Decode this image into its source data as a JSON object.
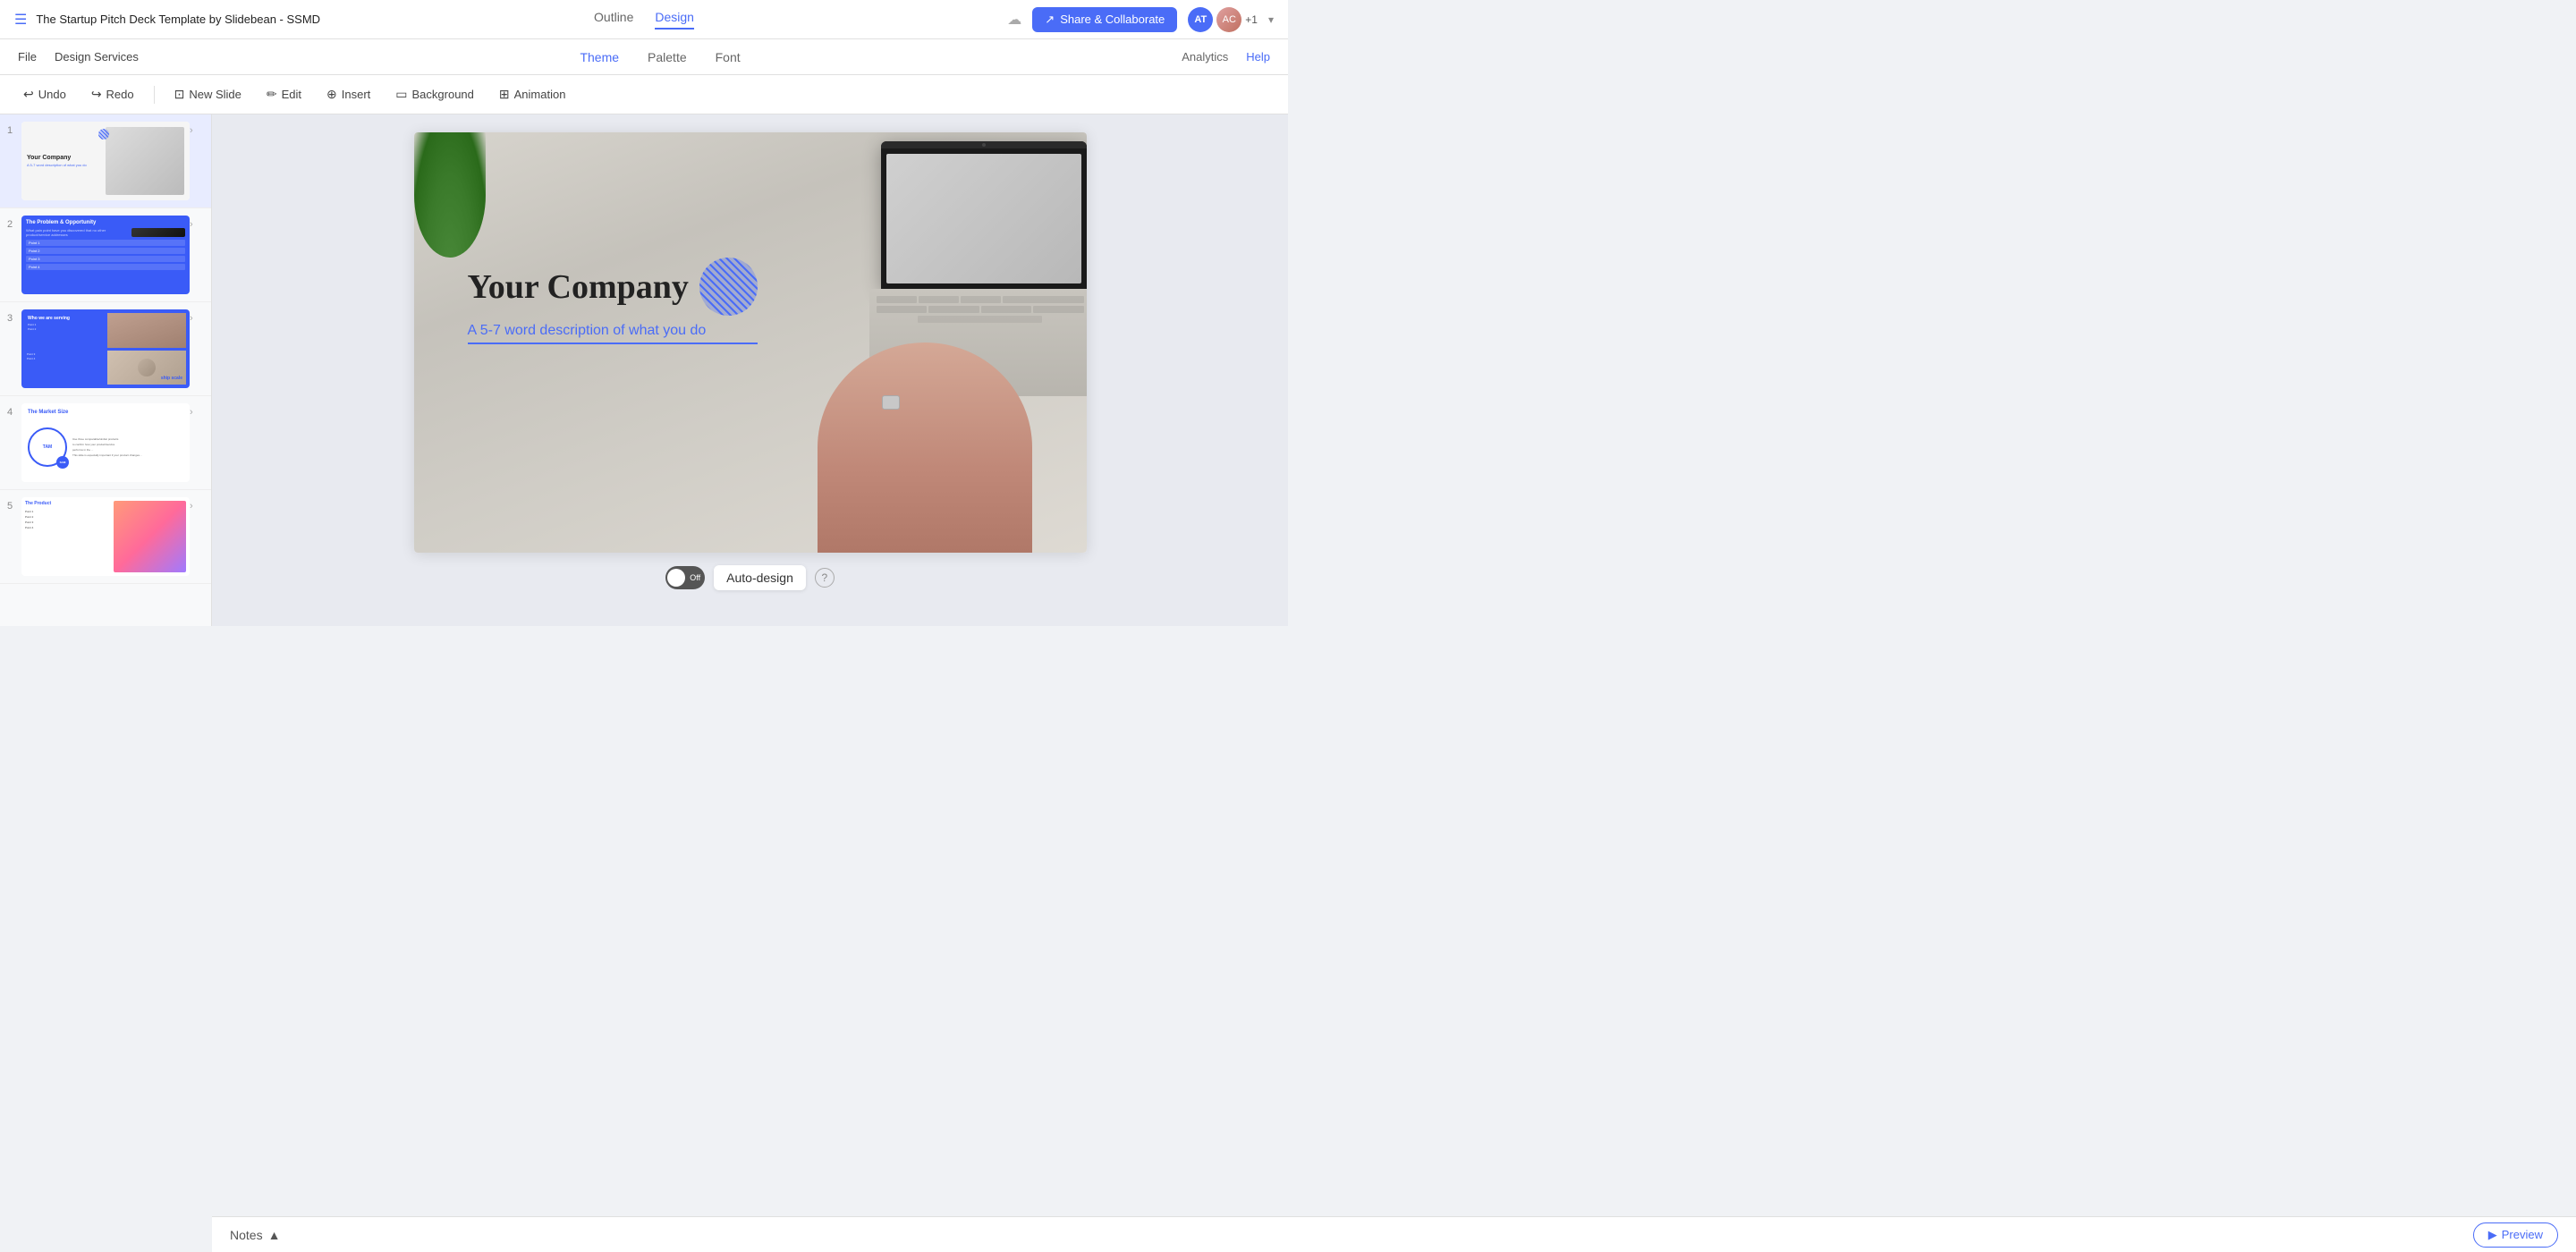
{
  "app": {
    "title": "The Startup Pitch Deck Template by Slidebean - SSMD"
  },
  "top_nav": {
    "outline_tab": "Outline",
    "design_tab": "Design",
    "share_btn": "Share & Collaborate",
    "avatar_initials": "AT",
    "avatar2_initials": "AC",
    "plus_count": "+1"
  },
  "second_nav": {
    "file": "File",
    "design_services": "Design Services",
    "theme": "Theme",
    "palette": "Palette",
    "font": "Font",
    "analytics": "Analytics",
    "help": "Help"
  },
  "toolbar": {
    "undo": "Undo",
    "redo": "Redo",
    "new_slide": "New Slide",
    "edit": "Edit",
    "insert": "Insert",
    "background": "Background",
    "animation": "Animation"
  },
  "slides": [
    {
      "num": "1",
      "title": "Your Company",
      "subtitle": "A 5-7 word description of what you do"
    },
    {
      "num": "2",
      "title": "The Problem & Opportunity"
    },
    {
      "num": "3",
      "title": "Who we are serving ship scale"
    },
    {
      "num": "4",
      "title": "The Market Size"
    },
    {
      "num": "5",
      "title": "The Product"
    }
  ],
  "canvas": {
    "company_title": "Your Company",
    "description": "A 5-7 word description of what you do"
  },
  "autodesign": {
    "toggle_state": "Off",
    "label": "Auto-design",
    "help_icon": "?"
  },
  "notes": {
    "label": "Notes",
    "chevron": "▲"
  },
  "preview": {
    "label": "Preview",
    "icon": "▶"
  }
}
